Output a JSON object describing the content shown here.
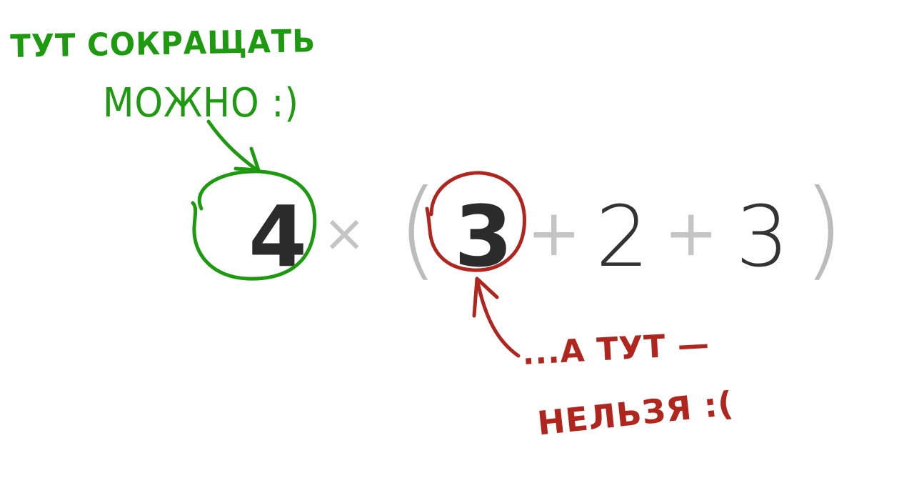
{
  "expression": {
    "term1": "4",
    "times": "×",
    "open_paren": "(",
    "a": "3",
    "plus1": "+",
    "b": "2",
    "plus2": "+",
    "c": "3",
    "close_paren": ")"
  },
  "annotations": {
    "green_line1": "ТУТ СОКРАЩАТЬ",
    "green_line2": "МОЖНО :)",
    "red_line1": "...А ТУТ —",
    "red_line2": "НЕЛЬЗЯ :("
  },
  "colors": {
    "green": "#1e9a10",
    "red": "#b0261f",
    "dark": "#2b2b2b",
    "gray": "#c4c4c4"
  }
}
